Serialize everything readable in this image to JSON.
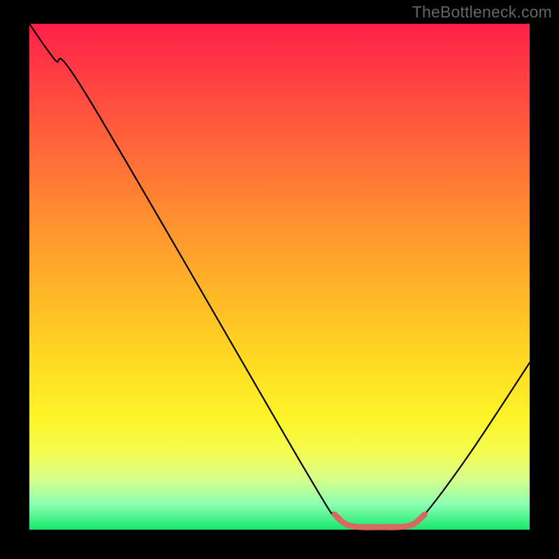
{
  "watermark": "TheBottleneck.com",
  "chart_data": {
    "type": "line",
    "title": "",
    "xlabel": "",
    "ylabel": "",
    "xlim": [
      0,
      100
    ],
    "ylim": [
      0,
      100
    ],
    "gradient_colors": {
      "top": "#ff1f49",
      "mid_upper": "#ff8832",
      "mid": "#ffd823",
      "mid_lower": "#f4fd53",
      "bottom": "#17e86c"
    },
    "curve_points": [
      {
        "x": 0,
        "y": 100
      },
      {
        "x": 5,
        "y": 93
      },
      {
        "x": 12,
        "y": 85
      },
      {
        "x": 55,
        "y": 12
      },
      {
        "x": 61,
        "y": 3
      },
      {
        "x": 64,
        "y": 0.8
      },
      {
        "x": 70,
        "y": 0.5
      },
      {
        "x": 76,
        "y": 0.8
      },
      {
        "x": 79,
        "y": 3
      },
      {
        "x": 88,
        "y": 15
      },
      {
        "x": 100,
        "y": 33
      }
    ],
    "series": [
      {
        "name": "bottleneck-curve",
        "stroke": "#000000",
        "stroke_width": 2.2
      },
      {
        "name": "highlight-segment",
        "stroke": "#d66a62",
        "stroke_width": 8.5,
        "range_x": [
          63,
          78
        ]
      }
    ]
  }
}
